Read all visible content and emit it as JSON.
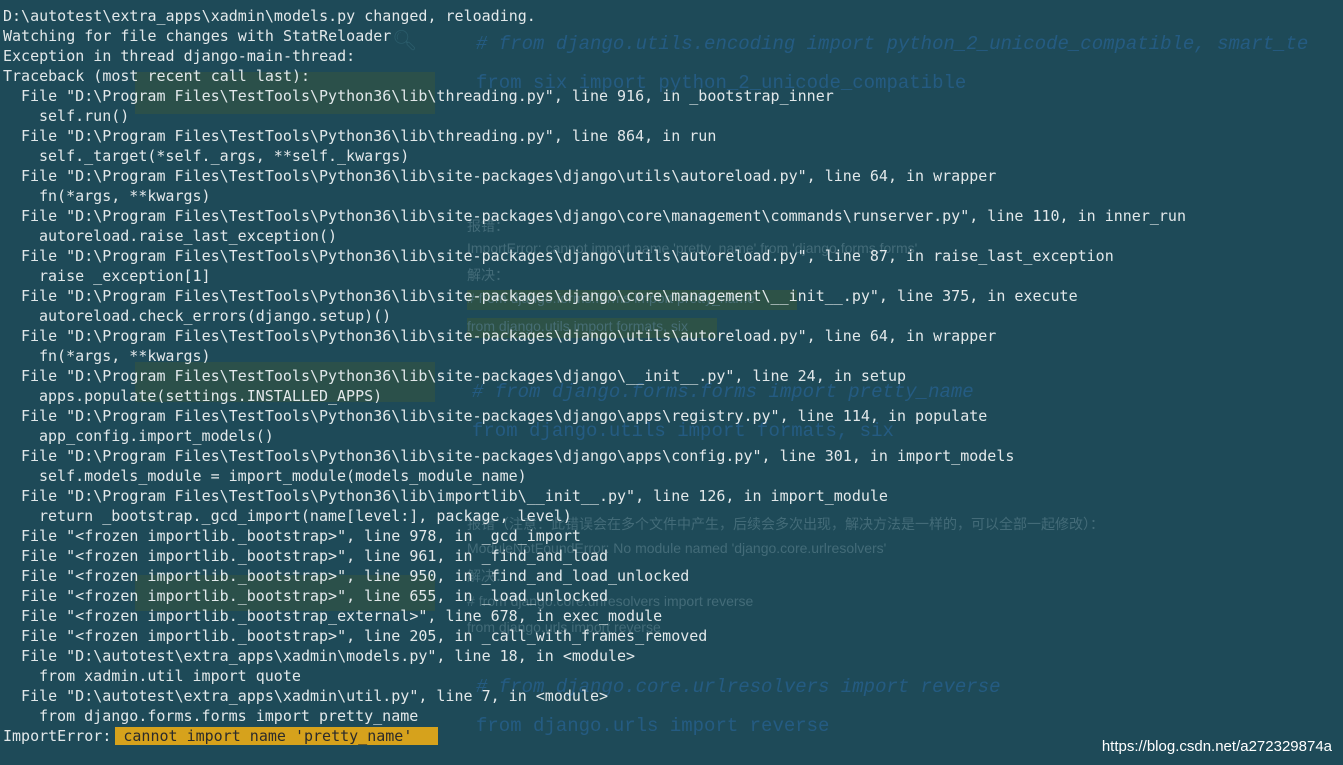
{
  "background_page": {
    "code_lines": [
      "# from django.utils.encoding import python_2_unicode_compatible, smart_te",
      "from six import python_2_unicode_compatible",
      "# from django.forms.forms import pretty_name",
      "from django.utils import formats, six",
      "# from django.core.urlresolvers import reverse",
      "from django.urls import reverse"
    ],
    "text_lines": [
      "报错：",
      "ImportError: cannot import name 'pretty_name' from 'django.forms.forms'",
      "解决：",
      "# from django.forms.forms import pretty_name",
      "from django.utils import formats, six",
      "报错（注意：此错误会在多个文件中产生，后续会多次出现，解决方法是一样的，可以全部一起修改）：",
      "ModuleNotFoundError: No module named 'django.core.urlresolvers'",
      "解决：",
      "# from django.core.urlresolvers import reverse",
      "from django.urls import reverse"
    ]
  },
  "terminal": {
    "lines": [
      {
        "indent": 0,
        "text": "D:\\autotest\\extra_apps\\xadmin\\models.py changed, reloading."
      },
      {
        "indent": 0,
        "text": "Watching for file changes with StatReloader"
      },
      {
        "indent": 0,
        "text": "Exception in thread django-main-thread:"
      },
      {
        "indent": 0,
        "text": "Traceback (most recent call last):"
      },
      {
        "indent": 1,
        "text": "File \"D:\\Program Files\\TestTools\\Python36\\lib\\threading.py\", line 916, in _bootstrap_inner"
      },
      {
        "indent": 2,
        "text": "self.run()"
      },
      {
        "indent": 1,
        "text": "File \"D:\\Program Files\\TestTools\\Python36\\lib\\threading.py\", line 864, in run"
      },
      {
        "indent": 2,
        "text": "self._target(*self._args, **self._kwargs)"
      },
      {
        "indent": 1,
        "text": "File \"D:\\Program Files\\TestTools\\Python36\\lib\\site-packages\\django\\utils\\autoreload.py\", line 64, in wrapper"
      },
      {
        "indent": 2,
        "text": "fn(*args, **kwargs)"
      },
      {
        "indent": 1,
        "text": "File \"D:\\Program Files\\TestTools\\Python36\\lib\\site-packages\\django\\core\\management\\commands\\runserver.py\", line 110, in inner_run"
      },
      {
        "indent": 2,
        "text": "autoreload.raise_last_exception()"
      },
      {
        "indent": 1,
        "text": "File \"D:\\Program Files\\TestTools\\Python36\\lib\\site-packages\\django\\utils\\autoreload.py\", line 87, in raise_last_exception"
      },
      {
        "indent": 2,
        "text": "raise _exception[1]"
      },
      {
        "indent": 1,
        "text": "File \"D:\\Program Files\\TestTools\\Python36\\lib\\site-packages\\django\\core\\management\\__init__.py\", line 375, in execute"
      },
      {
        "indent": 2,
        "text": "autoreload.check_errors(django.setup)()"
      },
      {
        "indent": 1,
        "text": "File \"D:\\Program Files\\TestTools\\Python36\\lib\\site-packages\\django\\utils\\autoreload.py\", line 64, in wrapper"
      },
      {
        "indent": 2,
        "text": "fn(*args, **kwargs)"
      },
      {
        "indent": 1,
        "text": "File \"D:\\Program Files\\TestTools\\Python36\\lib\\site-packages\\django\\__init__.py\", line 24, in setup"
      },
      {
        "indent": 2,
        "text": "apps.populate(settings.INSTALLED_APPS)"
      },
      {
        "indent": 1,
        "text": "File \"D:\\Program Files\\TestTools\\Python36\\lib\\site-packages\\django\\apps\\registry.py\", line 114, in populate"
      },
      {
        "indent": 2,
        "text": "app_config.import_models()"
      },
      {
        "indent": 1,
        "text": "File \"D:\\Program Files\\TestTools\\Python36\\lib\\site-packages\\django\\apps\\config.py\", line 301, in import_models"
      },
      {
        "indent": 2,
        "text": "self.models_module = import_module(models_module_name)"
      },
      {
        "indent": 1,
        "text": "File \"D:\\Program Files\\TestTools\\Python36\\lib\\importlib\\__init__.py\", line 126, in import_module"
      },
      {
        "indent": 2,
        "text": "return _bootstrap._gcd_import(name[level:], package, level)"
      },
      {
        "indent": 1,
        "text": "File \"<frozen importlib._bootstrap>\", line 978, in _gcd_import"
      },
      {
        "indent": 1,
        "text": "File \"<frozen importlib._bootstrap>\", line 961, in _find_and_load"
      },
      {
        "indent": 1,
        "text": "File \"<frozen importlib._bootstrap>\", line 950, in _find_and_load_unlocked"
      },
      {
        "indent": 1,
        "text": "File \"<frozen importlib._bootstrap>\", line 655, in _load_unlocked"
      },
      {
        "indent": 1,
        "text": "File \"<frozen importlib._bootstrap_external>\", line 678, in exec_module"
      },
      {
        "indent": 1,
        "text": "File \"<frozen importlib._bootstrap>\", line 205, in _call_with_frames_removed"
      },
      {
        "indent": 1,
        "text": "File \"D:\\autotest\\extra_apps\\xadmin\\models.py\", line 18, in <module>"
      },
      {
        "indent": 2,
        "text": "from xadmin.util import quote"
      },
      {
        "indent": 1,
        "text": "File \"D:\\autotest\\extra_apps\\xadmin\\util.py\", line 7, in <module>"
      },
      {
        "indent": 2,
        "text": "from django.forms.forms import pretty_name"
      }
    ],
    "error_prefix": "ImportError:",
    "error_message": "cannot import name 'pretty_name'"
  },
  "watermark": "https://blog.csdn.net/a272329874a"
}
